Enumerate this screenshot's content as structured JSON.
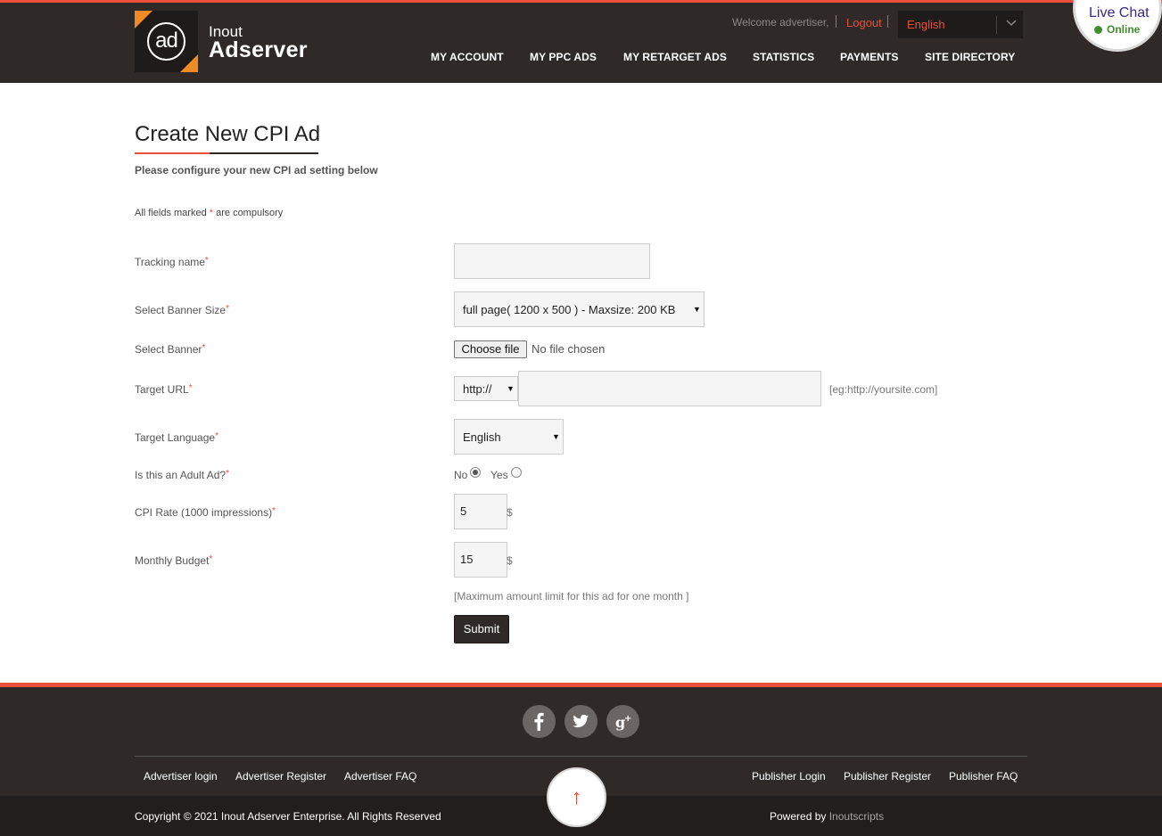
{
  "header": {
    "logo_mark": "ad",
    "logo_line1": "Inout",
    "logo_line2": "Adserver",
    "welcome": "Welcome advertiser,",
    "logout": "Logout",
    "language": "English",
    "nav": [
      "MY ACCOUNT",
      "MY PPC ADS",
      "MY RETARGET ADS",
      "STATISTICS",
      "PAYMENTS",
      "SITE DIRECTORY"
    ]
  },
  "live_chat": {
    "title": "Live Chat",
    "status": "Online",
    "status_color": "#3e8e2c"
  },
  "page": {
    "title": "Create New CPI Ad",
    "subtitle": "Please configure your new CPI ad setting below",
    "compulsory_prefix": "All fields marked",
    "compulsory_star": "*",
    "compulsory_suffix": "are compulsory"
  },
  "form": {
    "tracking_name": {
      "label": "Tracking name",
      "value": ""
    },
    "banner_size": {
      "label": "Select Banner Size",
      "value": "full page( 1200 x 500 ) - Maxsize: 200 KB"
    },
    "banner": {
      "label": "Select Banner",
      "button": "Choose file",
      "status": "No file chosen"
    },
    "target_url": {
      "label": "Target URL",
      "protocol": "http://",
      "value": "",
      "hint": "[eg:http://yoursite.com]"
    },
    "target_language": {
      "label": "Target Language",
      "value": "English"
    },
    "adult_ad": {
      "label": "Is this an Adult Ad?",
      "options": [
        "No",
        "Yes"
      ],
      "selected": "No"
    },
    "cpi_rate": {
      "label": "CPI Rate (1000 impressions)",
      "value": "5",
      "currency": "$"
    },
    "monthly_budget": {
      "label": "Monthly Budget",
      "value": "15",
      "currency": "$",
      "hint": "[Maximum amount limit for this ad for one month ]"
    },
    "submit": "Submit"
  },
  "footer": {
    "social": [
      "f",
      "t",
      "g+"
    ],
    "advertiser_links": [
      "Advertiser login",
      "Advertiser Register",
      "Advertiser FAQ"
    ],
    "publisher_links": [
      "Publisher Login",
      "Publisher Register",
      "Publisher FAQ"
    ],
    "copyright": "Copyright © 2021 Inout Adserver Enterprise. All Rights Reserved",
    "powered_prefix": "Powered by",
    "powered_brand": "Inoutscripts",
    "up_arrow": "↑"
  },
  "colors": {
    "accent": "#e8503a",
    "header_bg": "#2f2a28",
    "logo_orange": "#f08a24"
  }
}
